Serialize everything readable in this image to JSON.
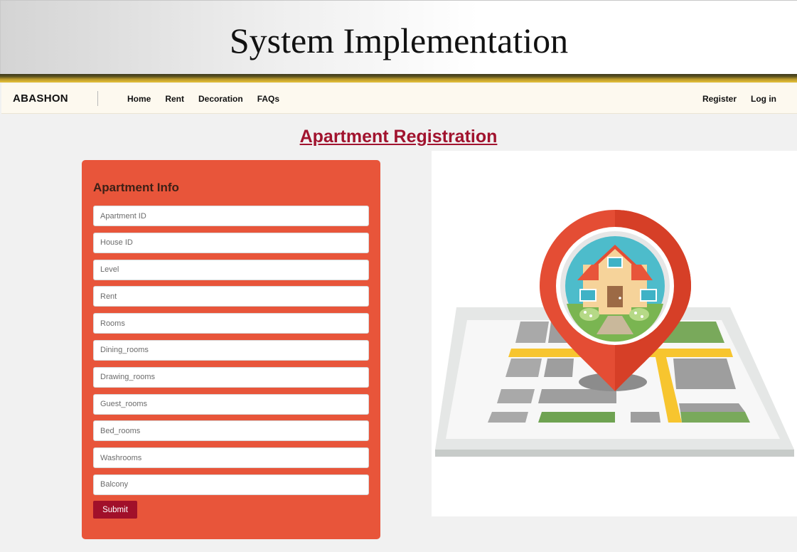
{
  "slide": {
    "title": "System Implementation"
  },
  "nav": {
    "brand": "ABASHON",
    "links": [
      "Home",
      "Rent",
      "Decoration",
      "FAQs"
    ],
    "right_links": [
      "Register",
      "Log in"
    ]
  },
  "page": {
    "heading": "Apartment Registration"
  },
  "form": {
    "title": "Apartment Info",
    "fields": [
      {
        "placeholder": "Apartment ID",
        "value": ""
      },
      {
        "placeholder": "House ID",
        "value": ""
      },
      {
        "placeholder": "Level",
        "value": ""
      },
      {
        "placeholder": "Rent",
        "value": ""
      },
      {
        "placeholder": "Rooms",
        "value": ""
      },
      {
        "placeholder": "Dining_rooms",
        "value": ""
      },
      {
        "placeholder": "Drawing_rooms",
        "value": ""
      },
      {
        "placeholder": "Guest_rooms",
        "value": ""
      },
      {
        "placeholder": "Bed_rooms",
        "value": ""
      },
      {
        "placeholder": "Washrooms",
        "value": ""
      },
      {
        "placeholder": "Balcony",
        "value": ""
      }
    ],
    "submit_label": "Submit"
  },
  "illustration": {
    "icon": "house-map-pin-icon"
  },
  "colors": {
    "form_bg": "#e8553a",
    "accent": "#a1132e",
    "nav_bg": "#fdf9ef",
    "page_bg": "#f1f1f1"
  }
}
